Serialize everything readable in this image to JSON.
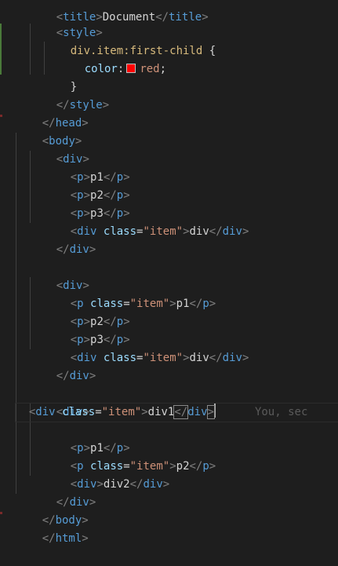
{
  "code": {
    "l0": {
      "open": "<",
      "t1": "title",
      "gt": ">",
      "txt": "Document",
      "close_open": "</",
      "t2": "title",
      "close_gt": ">"
    },
    "l1": {
      "open": "<",
      "t": "style",
      "gt": ">"
    },
    "l2": {
      "selector": "div.item:first-child",
      "brace": " {"
    },
    "l3": {
      "prop": "color",
      "colon": ":",
      "value": "red",
      "semi": ";",
      "swatch_color": "#ff0000"
    },
    "l4": {
      "brace": "}"
    },
    "l5": {
      "open": "</",
      "t": "style",
      "gt": ">"
    },
    "l6": {
      "open": "</",
      "t": "head",
      "gt": ">"
    },
    "l7": {
      "open": "<",
      "t": "body",
      "gt": ">"
    },
    "l8": {
      "open": "<",
      "t": "div",
      "gt": ">"
    },
    "l9": {
      "o1": "<",
      "t": "p",
      "g1": ">",
      "txt": "p1",
      "o2": "</",
      "g2": ">"
    },
    "l10": {
      "o1": "<",
      "t": "p",
      "g1": ">",
      "txt": "p2",
      "o2": "</",
      "g2": ">"
    },
    "l11": {
      "o1": "<",
      "t": "p",
      "g1": ">",
      "txt": "p3",
      "o2": "</",
      "g2": ">"
    },
    "l12": {
      "o1": "<",
      "t": "div",
      "attr": "class",
      "eq": "=",
      "val": "\"item\"",
      "g1": ">",
      "txt": "div",
      "o2": "</",
      "g2": ">"
    },
    "l13": {
      "open": "</",
      "t": "div",
      "gt": ">"
    },
    "l15": {
      "open": "<",
      "t": "div",
      "gt": ">"
    },
    "l16": {
      "o1": "<",
      "t": "p",
      "attr": "class",
      "eq": "=",
      "val": "\"item\"",
      "g1": ">",
      "txt": "p1",
      "o2": "</",
      "g2": ">"
    },
    "l17": {
      "o1": "<",
      "t": "p",
      "g1": ">",
      "txt": "p2",
      "o2": "</",
      "g2": ">"
    },
    "l18": {
      "o1": "<",
      "t": "p",
      "g1": ">",
      "txt": "p3",
      "o2": "</",
      "g2": ">"
    },
    "l19": {
      "o1": "<",
      "t": "div",
      "attr": "class",
      "eq": "=",
      "val": "\"item\"",
      "g1": ">",
      "txt": "div",
      "o2": "</",
      "g2": ">"
    },
    "l20": {
      "open": "</",
      "t": "div",
      "gt": ">"
    },
    "l22": {
      "open": "<",
      "t": "div",
      "gt": ">"
    },
    "l23": {
      "o1": "<",
      "t": "div",
      "attr": "class",
      "eq": "=",
      "val": "\"item\"",
      "g1": ">",
      "txt": "div1",
      "o2": "</",
      "g2": ">",
      "ghost": "You, sec"
    },
    "l24": {
      "o1": "<",
      "t": "p",
      "g1": ">",
      "txt": "p1",
      "o2": "</",
      "g2": ">"
    },
    "l25": {
      "o1": "<",
      "t": "p",
      "attr": "class",
      "eq": "=",
      "val": "\"item\"",
      "g1": ">",
      "txt": "p2",
      "o2": "</",
      "g2": ">"
    },
    "l26": {
      "o1": "<",
      "t": "div",
      "g1": ">",
      "txt": "div2",
      "o2": "</",
      "g2": ">"
    },
    "l27": {
      "open": "</",
      "t": "div",
      "gt": ">"
    },
    "l28": {
      "open": "</",
      "t": "body",
      "gt": ">"
    },
    "l29": {
      "open": "</",
      "t": "html",
      "gt": ">"
    }
  }
}
